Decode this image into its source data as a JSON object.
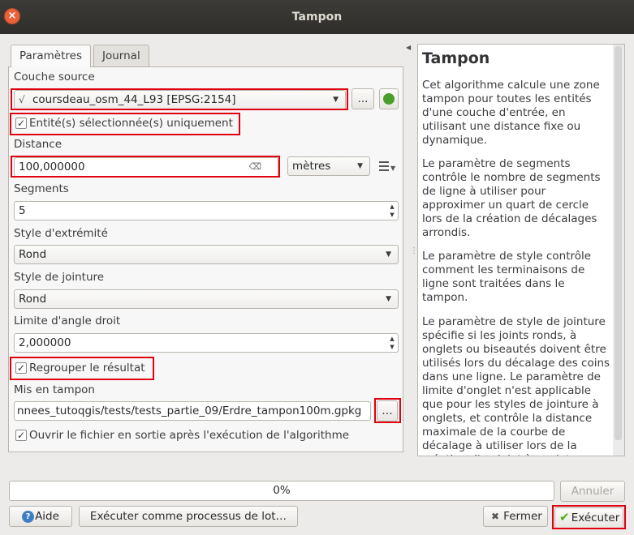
{
  "window": {
    "title": "Tampon"
  },
  "tabs": [
    {
      "label": "Paramètres"
    },
    {
      "label": "Journal"
    }
  ],
  "form": {
    "source_layer_label": "Couche source",
    "source_layer_value": "coursdeau_osm_44_L93 [EPSG:2154]",
    "selected_only_label": "Entité(s) sélectionnée(s) uniquement",
    "distance_label": "Distance",
    "distance_value": "100,000000",
    "distance_unit": "mètres",
    "segments_label": "Segments",
    "segments_value": "5",
    "end_cap_label": "Style d'extrémité",
    "end_cap_value": "Rond",
    "join_label": "Style de jointure",
    "join_value": "Rond",
    "miter_label": "Limite d'angle droit",
    "miter_value": "2,000000",
    "dissolve_label": "Regrouper le résultat",
    "output_label": "Mis en tampon",
    "output_value": "nnees_tutoqgis/tests/tests_partie_09/Erdre_tampon100m.gpkg",
    "open_output_label": "Ouvrir le fichier en sortie après l'exécution de l'algorithme",
    "ellipsis": "…",
    "browse": "..."
  },
  "help": {
    "title": "Tampon",
    "p1": "Cet algorithme calcule une zone tampon pour toutes les entités d'une couche d'entrée, en utilisant une distance fixe ou dynamique.",
    "p2": "Le paramètre de segments contrôle le nombre de segments de ligne à utiliser pour approximer un quart de cercle lors de la création de décalages arrondis.",
    "p3": "Le paramètre de style contrôle comment les terminaisons de ligne sont traitées dans le tampon.",
    "p4": "Le paramètre de style de jointure spécifie si les joints ronds, à onglets ou biseautés doivent être utilisés lors du décalage des coins dans une ligne. Le paramètre de limite d'onglet n'est applicable que pour les styles de jointure à onglets, et contrôle la distance maximale de la courbe de décalage à utiliser lors de la création d'un joint à onglet."
  },
  "progress": {
    "text": "0%",
    "value": 0
  },
  "buttons": {
    "cancel": "Annuler",
    "help": "Aide",
    "batch": "Exécuter comme processus de lot…",
    "close": "Fermer",
    "run": "Exécuter"
  },
  "colors": {
    "highlight": "#e0000f",
    "titlebar": "#3c3b37",
    "close": "#e9613a",
    "run_check": "#4caf1e"
  }
}
